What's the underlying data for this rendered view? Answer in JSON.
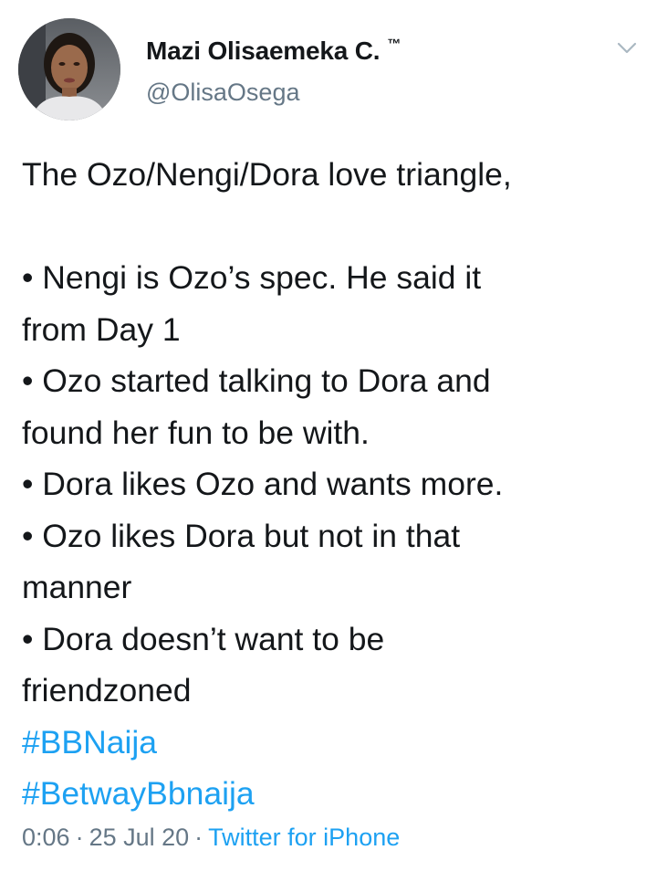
{
  "author": {
    "name": "Mazi Olisaemeka C.",
    "trademark": "™",
    "handle": "@OlisaOsega"
  },
  "tweet": {
    "lines": [
      "The Ozo/Nengi/Dora love triangle,",
      "",
      "• Nengi is Ozo’s spec. He said it",
      "from Day 1",
      "• Ozo started talking to Dora and",
      "found her fun to be with.",
      "• Dora likes Ozo and wants more.",
      "• Ozo likes Dora but not in that",
      "manner",
      "• Dora doesn’t want to be",
      "friendzoned"
    ],
    "hashtags": [
      "#BBNaija",
      "#BetwayBbnaija"
    ]
  },
  "meta": {
    "time": "0:06",
    "separator": "·",
    "date": "25 Jul 20",
    "source": "Twitter for iPhone"
  },
  "icons": {
    "caret": "chevron-down-icon"
  },
  "colors": {
    "link": "#1da1f2",
    "secondary_text": "#657786",
    "primary_text": "#14171a"
  }
}
